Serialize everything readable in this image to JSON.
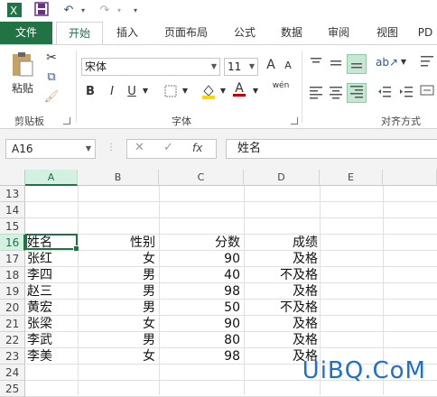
{
  "colors": {
    "accent": "#217346",
    "watermark": "#1d6fd0",
    "font_color": "#c00000",
    "fill_color": "#ffd700"
  },
  "qat": {
    "app_icon": "excel-icon",
    "save_icon": "save-icon",
    "undo_icon": "undo-icon",
    "redo_icon": "redo-icon"
  },
  "tabs": [
    "文件",
    "开始",
    "插入",
    "页面布局",
    "公式",
    "数据",
    "审阅",
    "视图",
    "PD"
  ],
  "ribbon": {
    "clipboard": {
      "paste_label": "粘贴",
      "group_label": "剪贴板"
    },
    "font": {
      "font_name": "宋体",
      "font_size": "11",
      "bold": "B",
      "italic": "I",
      "underline": "U",
      "grow": "A",
      "shrink": "A",
      "wen": "wén",
      "group_label": "字体"
    },
    "align": {
      "group_label": "对齐方式"
    }
  },
  "formula_bar": {
    "name_box": "A16",
    "cancel": "✕",
    "enter": "✓",
    "fx": "fx",
    "content": "姓名"
  },
  "columns": [
    "A",
    "B",
    "C",
    "D",
    "E"
  ],
  "rows": [
    {
      "num": "13",
      "cells": [
        "",
        "",
        "",
        ""
      ]
    },
    {
      "num": "14",
      "cells": [
        "",
        "",
        "",
        ""
      ]
    },
    {
      "num": "15",
      "cells": [
        "",
        "",
        "",
        ""
      ]
    },
    {
      "num": "16",
      "cells": [
        "姓名",
        "性别",
        "分数",
        "成绩"
      ]
    },
    {
      "num": "17",
      "cells": [
        "张红",
        "女",
        "90",
        "及格"
      ]
    },
    {
      "num": "18",
      "cells": [
        "李四",
        "男",
        "40",
        "不及格"
      ]
    },
    {
      "num": "19",
      "cells": [
        "赵三",
        "男",
        "98",
        "及格"
      ]
    },
    {
      "num": "20",
      "cells": [
        "黄宏",
        "男",
        "50",
        "不及格"
      ]
    },
    {
      "num": "21",
      "cells": [
        "张梁",
        "女",
        "90",
        "及格"
      ]
    },
    {
      "num": "22",
      "cells": [
        "李武",
        "男",
        "80",
        "及格"
      ]
    },
    {
      "num": "23",
      "cells": [
        "李美",
        "女",
        "98",
        "及格"
      ]
    },
    {
      "num": "24",
      "cells": [
        "",
        "",
        "",
        ""
      ]
    },
    {
      "num": "25",
      "cells": [
        "",
        "",
        "",
        ""
      ]
    }
  ],
  "watermark": "UiBQ.CoM"
}
